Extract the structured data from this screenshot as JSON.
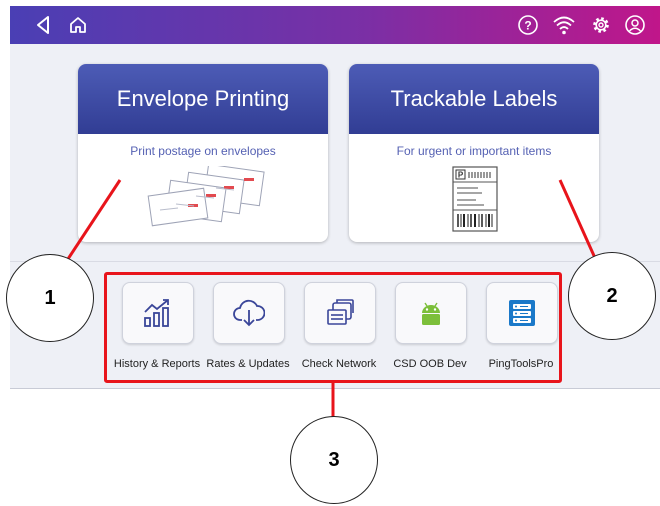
{
  "topbar": {
    "icons": [
      "back-icon",
      "home-icon",
      "help-icon",
      "wifi-icon",
      "settings-icon",
      "account-icon"
    ],
    "help_glyph": "?"
  },
  "cards": [
    {
      "title": "Envelope Printing",
      "subtitle": "Print postage on envelopes"
    },
    {
      "title": "Trackable Labels",
      "subtitle": "For urgent or important items"
    }
  ],
  "apps": [
    {
      "label": "History & Reports",
      "icon": "history-reports-icon"
    },
    {
      "label": "Rates & Updates",
      "icon": "cloud-download-icon"
    },
    {
      "label": "Check Network",
      "icon": "check-network-icon"
    },
    {
      "label": "CSD OOB Dev",
      "icon": "android-icon"
    },
    {
      "label": "PingToolsPro",
      "icon": "pingtools-icon"
    }
  ],
  "callouts": [
    "1",
    "2",
    "3"
  ],
  "colors": {
    "accent_red": "#e8141b",
    "header_blue": "#3a4699",
    "brand_purple": "#7b2fa5"
  }
}
